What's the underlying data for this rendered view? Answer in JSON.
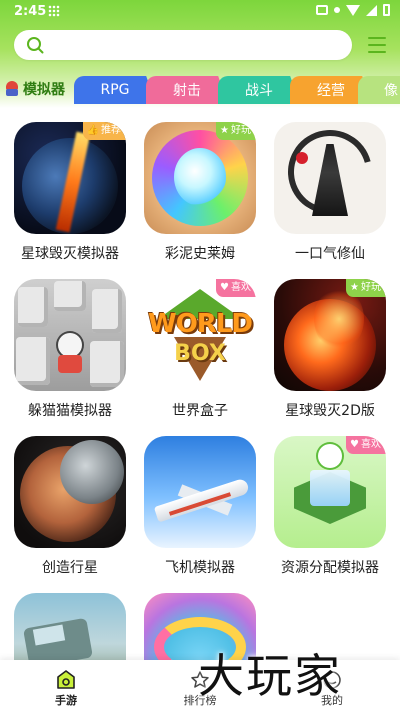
{
  "status_bar": {
    "time": "2:45"
  },
  "search": {
    "placeholder": "",
    "value": ""
  },
  "tabs": {
    "active": "模拟器",
    "items": [
      "RPG",
      "射击",
      "战斗",
      "经营",
      "像"
    ]
  },
  "apps": [
    {
      "name": "星球毁灭模拟器",
      "badge": "推荐",
      "badge_color": "#f8b54a",
      "icon": "planet-explosion-icon"
    },
    {
      "name": "彩泥史莱姆",
      "badge": "好玩",
      "badge_color": "#8ed24a",
      "icon": "slime-swirl-icon"
    },
    {
      "name": "一口气修仙",
      "badge": "",
      "icon": "ink-cultivator-icon"
    },
    {
      "name": "躲猫猫模拟器",
      "badge": "",
      "icon": "hide-and-seek-icon"
    },
    {
      "name": "世界盒子",
      "badge": "喜欢",
      "badge_color": "#f5739f",
      "icon": "worldbox-icon"
    },
    {
      "name": "星球毁灭2D版",
      "badge": "好玩",
      "badge_color": "#8ed24a",
      "icon": "planet-fire-icon"
    },
    {
      "name": "创造行星",
      "badge": "",
      "icon": "planets-icon"
    },
    {
      "name": "飞机模拟器",
      "badge": "",
      "icon": "airplane-icon"
    },
    {
      "name": "资源分配模拟器",
      "badge": "喜欢",
      "badge_color": "#f5739f",
      "icon": "resource-map-icon"
    },
    {
      "name": "",
      "badge": "",
      "icon": "truck-icon"
    },
    {
      "name": "",
      "badge": "",
      "icon": "slime-ring-icon"
    }
  ],
  "bottom_nav": {
    "items": [
      {
        "label": "手游",
        "active": true
      },
      {
        "label": "排行榜",
        "active": false
      },
      {
        "label": "我的",
        "active": false
      }
    ]
  },
  "watermark": "大玩家",
  "colors": {
    "accent": "#7dd63c",
    "active_tab_text": "#2f7d12"
  }
}
